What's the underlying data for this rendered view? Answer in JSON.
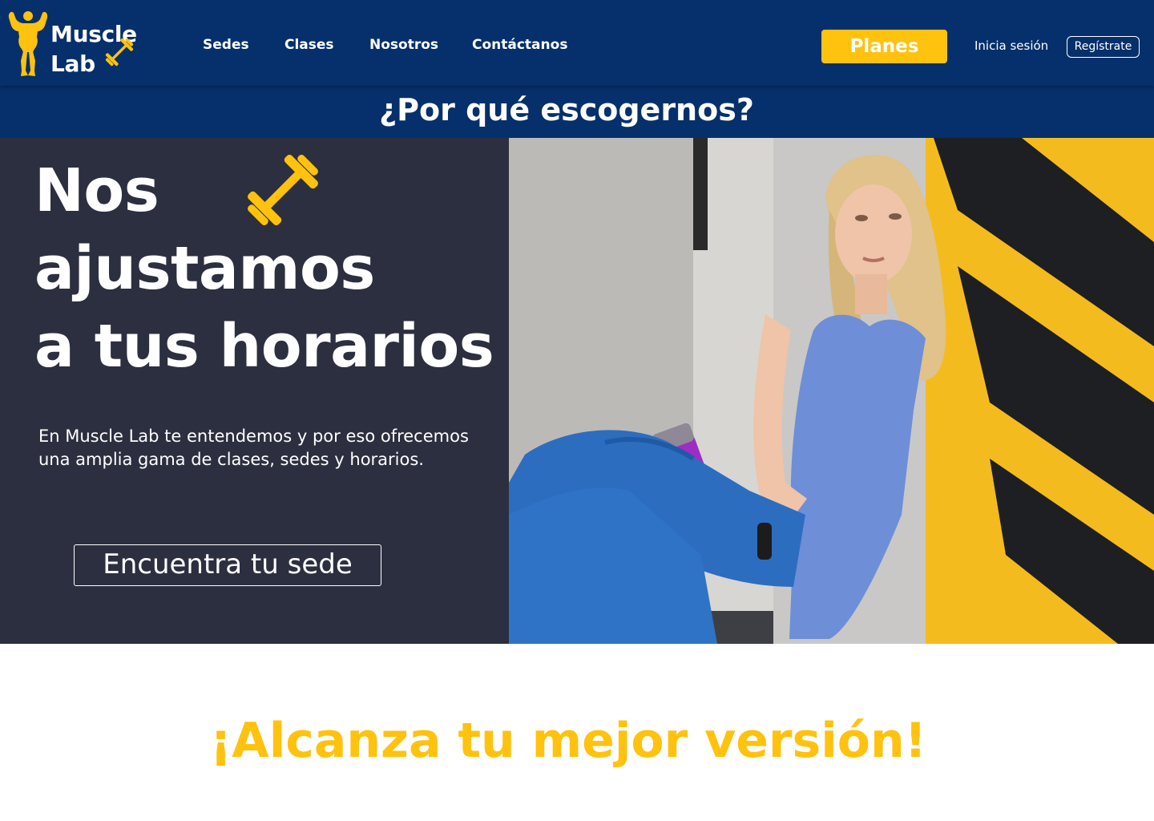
{
  "brand": {
    "name_line1": "Muscle",
    "name_line2": "Lab",
    "logo_icon": "bodybuilder-icon",
    "accent_icon": "dumbbell-icon",
    "colors": {
      "navy": "#05306b",
      "accent_yellow": "#ffc20e",
      "hero_panel": "#2c2f3f",
      "text_light": "#ffffff"
    }
  },
  "nav": {
    "links": [
      {
        "label": "Sedes"
      },
      {
        "label": "Clases"
      },
      {
        "label": "Nosotros"
      },
      {
        "label": "Contáctanos"
      }
    ],
    "plans_label": "Planes",
    "login_label": "Inicia sesión",
    "register_label": "Regístrate"
  },
  "why": {
    "title": "¿Por qué escogernos?"
  },
  "hero": {
    "heading_line1": "Nos",
    "heading_line2": "ajustamos",
    "heading_line3": "a tus horarios",
    "description": "En Muscle Lab te entendemos y por eso ofrecemos una amplia gama de clases, sedes y horarios.",
    "cta_label": "Encuentra tu sede"
  },
  "bottom": {
    "title": "¡Alcanza tu mejor versión!"
  }
}
